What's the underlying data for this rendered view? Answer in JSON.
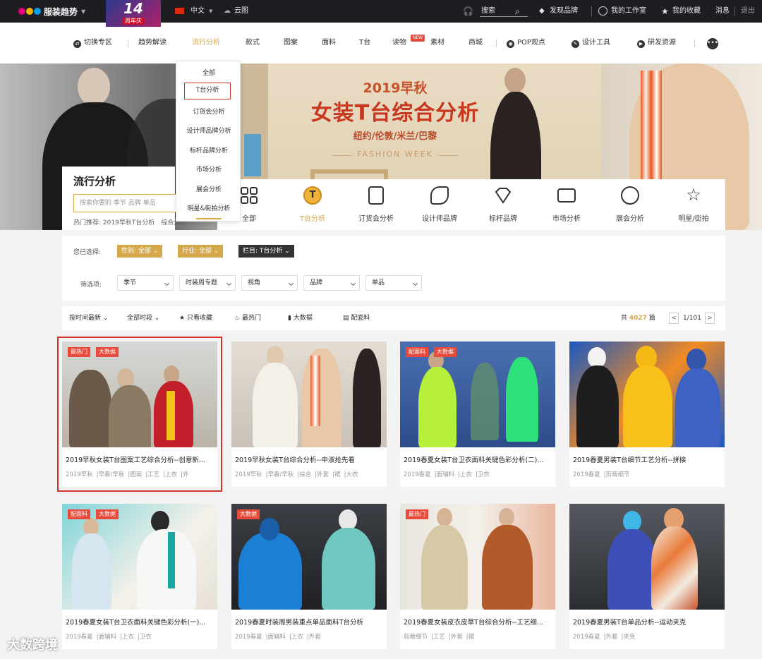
{
  "topbar": {
    "brand": "服装趋势",
    "anniversary_number": "14",
    "anniversary_label": "周年庆",
    "language": "中文",
    "cloud": "云图",
    "search_label": "搜索",
    "discover": "发现品牌",
    "studio": "我的工作室",
    "favorites": "我的收藏",
    "messages": "消息",
    "logout": "退出"
  },
  "nav": {
    "items": [
      {
        "label": "切换专区"
      },
      {
        "label": "趋势解读"
      },
      {
        "label": "流行分析"
      },
      {
        "label": "款式"
      },
      {
        "label": "图案"
      },
      {
        "label": "面料"
      },
      {
        "label": "T台"
      },
      {
        "label": "读物"
      },
      {
        "label": "素材"
      },
      {
        "label": "商城"
      },
      {
        "label": "POP观点"
      },
      {
        "label": "设计工具"
      },
      {
        "label": "研发资源"
      }
    ],
    "new_badge": "NEW",
    "active_index": 2
  },
  "dropdown": {
    "options": [
      "全部",
      "T台分析",
      "订货会分析",
      "设计师品牌分析",
      "标杆品牌分析",
      "市场分析",
      "展会分析",
      "明星&街拍分析"
    ],
    "selected_index": 1
  },
  "banner": {
    "title_year": "2019早秋",
    "title_main": "女装T台综合分析",
    "cities": "纽约/伦敦/米兰/巴黎",
    "event": "FASHION WEEK"
  },
  "search_panel": {
    "title": "流行分析",
    "placeholder": "搜索你要的 季节 品牌 单品",
    "hot_prefix": "热门推荐:",
    "hot_items": [
      "2019早秋T台分析",
      "综合分析"
    ]
  },
  "categories": [
    {
      "label": "全部",
      "icon": "grid-icon"
    },
    {
      "label": "T台分析",
      "icon": "t-circle-icon"
    },
    {
      "label": "订货会分析",
      "icon": "document-icon"
    },
    {
      "label": "设计师品牌",
      "icon": "pencil-ruler-icon"
    },
    {
      "label": "标杆品牌",
      "icon": "diamond-icon"
    },
    {
      "label": "市场分析",
      "icon": "monitor-chart-icon"
    },
    {
      "label": "展会分析",
      "icon": "globe-icon"
    },
    {
      "label": "明星/街拍",
      "icon": "star-icon"
    }
  ],
  "categories_active_index": 1,
  "filters": {
    "selected_label": "您已选择:",
    "selected": [
      {
        "text": "性别: 全部",
        "style": "gold"
      },
      {
        "text": "行业: 全部",
        "style": "gold"
      },
      {
        "text": "栏目: T台分析",
        "style": "dark"
      }
    ],
    "screen_label": "筛选项:",
    "dropdowns": [
      "季节",
      "时装周专题",
      "视角",
      "品牌",
      "单品"
    ]
  },
  "sortbar": {
    "sort_time": "按时间最新",
    "all_time": "全部时段",
    "only_fav": "只看收藏",
    "hottest": "最热门",
    "big_data": "大数据",
    "with_fabric": "配面料",
    "total_prefix": "共",
    "total_count": "4027",
    "total_suffix": "篇",
    "page": "1/101",
    "prev": "<",
    "next": ">"
  },
  "cards": [
    {
      "title": "2019早秋女装T台图案工艺综合分析--创意新...",
      "badges": [
        "最热门",
        "大数据"
      ],
      "tags": [
        "2019早秋",
        "早春/早秋",
        "图案",
        "工艺",
        "上衣",
        "外"
      ]
    },
    {
      "title": "2019早秋女装T台综合分析--中淑抢先看",
      "badges": [],
      "tags": [
        "2019早秋",
        "早春/早秋",
        "综合",
        "外套",
        "裙",
        "大衣"
      ]
    },
    {
      "title": "2019春夏女装T台卫衣面料关键色彩分析(二)...",
      "badges": [
        "配面料",
        "大数据"
      ],
      "tags": [
        "2019春夏",
        "面辅料",
        "上衣",
        "卫衣"
      ]
    },
    {
      "title": "2019春夏男装T台细节工艺分析--拼接",
      "badges": [],
      "tags": [
        "2019春夏",
        "剪裁细节"
      ]
    },
    {
      "title": "2019春夏女装T台卫衣面料关键色彩分析(一)...",
      "badges": [
        "配面料",
        "大数据"
      ],
      "tags": [
        "2019春夏",
        "面辅料",
        "上衣",
        "卫衣"
      ]
    },
    {
      "title": "2019春夏时装周男装重点单品面料T台分析",
      "badges": [
        "大数据"
      ],
      "tags": [
        "2019春夏",
        "面辅料",
        "上衣",
        "外套"
      ]
    },
    {
      "title": "2019春夏女装皮衣皮草T台综合分析--工艺细...",
      "badges": [
        "最热门"
      ],
      "tags": [
        "剪裁细节",
        "工艺",
        "外套",
        "裙"
      ]
    },
    {
      "title": "2019春夏男装T台单品分析--运动夹克",
      "badges": [],
      "tags": [
        "2019春夏",
        "外套",
        "夹克"
      ]
    }
  ],
  "highlighted_card_index": 0,
  "watermark": "大数跨境",
  "colors": {
    "accent_gold": "#d4a84b",
    "badge_red": "#e84b3c",
    "highlight_red": "#d0342c",
    "topbar": "#1d1d22"
  }
}
